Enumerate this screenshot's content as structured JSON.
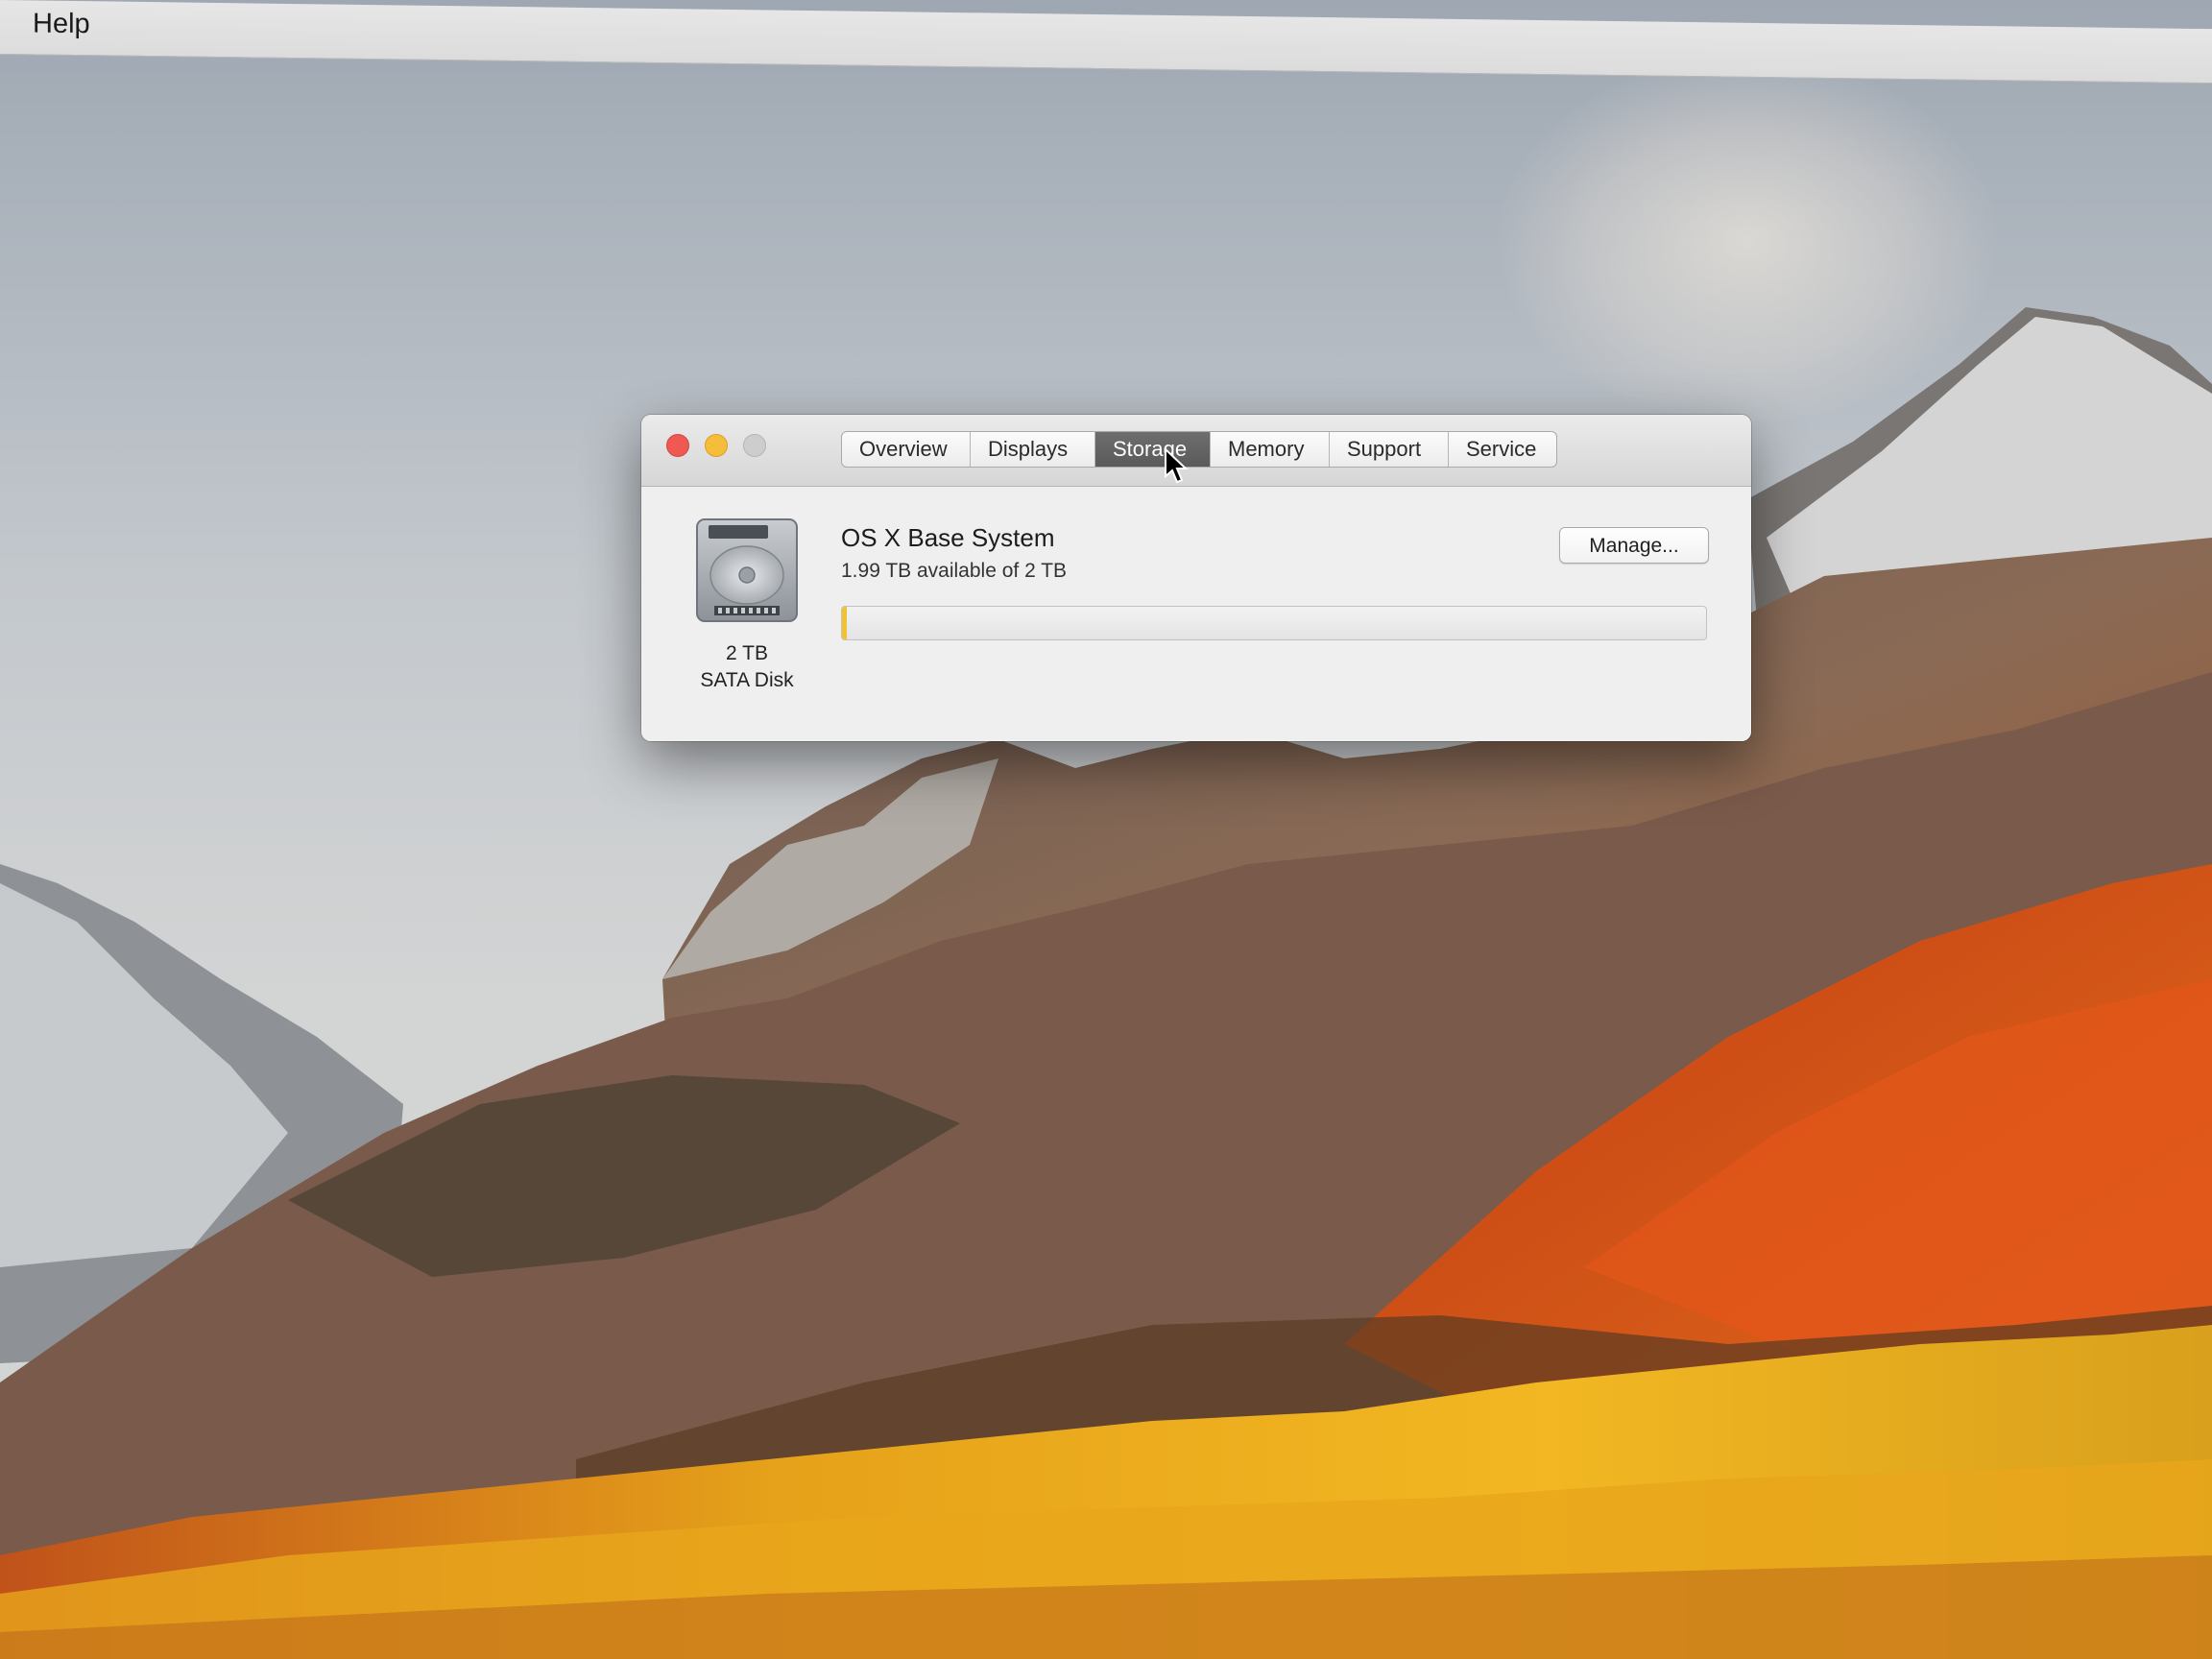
{
  "menubar": {
    "items": [
      "Help"
    ]
  },
  "window": {
    "tabs": [
      {
        "label": "Overview"
      },
      {
        "label": "Displays"
      },
      {
        "label": "Storage"
      },
      {
        "label": "Memory"
      },
      {
        "label": "Support"
      },
      {
        "label": "Service"
      }
    ],
    "active_tab": "Storage",
    "traffic_lights": {
      "close_color": "#ee5a52",
      "minimize_color": "#f5bd3a",
      "zoom_color": "#cdcdcd"
    }
  },
  "storage": {
    "disk_icon": "hard-disk-icon",
    "disk_size": "2 TB",
    "disk_type": "SATA Disk",
    "volume_name": "OS X Base System",
    "availability": "1.99 TB available of 2 TB",
    "used_fraction": 0.005,
    "bar_color": "#f1c232",
    "manage_label": "Manage..."
  }
}
